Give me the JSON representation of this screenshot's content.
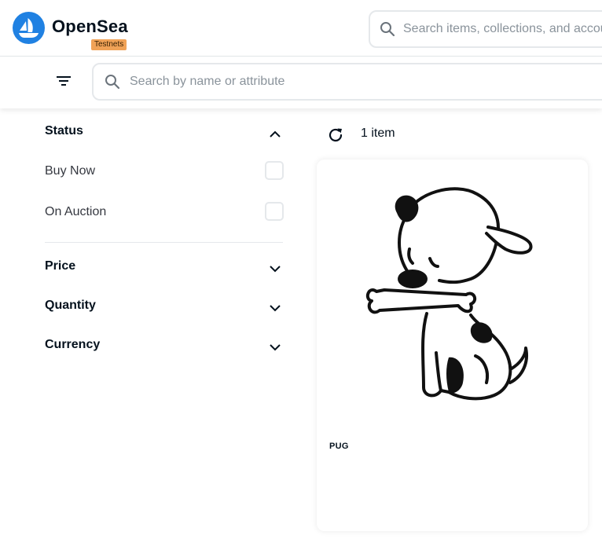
{
  "header": {
    "brand": "OpenSea",
    "badge": "Testnets",
    "search_placeholder": "Search items, collections, and accounts",
    "accent_color": "#2081e2",
    "badge_color": "#f0a257"
  },
  "filterbar": {
    "filter_icon": "filter-icon",
    "search_placeholder": "Search by name or attribute"
  },
  "sidebar": {
    "status": {
      "label": "Status",
      "expanded": true,
      "options": [
        {
          "label": "Buy Now",
          "checked": false
        },
        {
          "label": "On Auction",
          "checked": false
        }
      ]
    },
    "sections": [
      {
        "label": "Price",
        "expanded": false
      },
      {
        "label": "Quantity",
        "expanded": false
      },
      {
        "label": "Currency",
        "expanded": false
      }
    ]
  },
  "results": {
    "count": "1 item",
    "items": [
      {
        "name": "PUG",
        "image": "cartoon-dog-with-bone"
      }
    ]
  }
}
